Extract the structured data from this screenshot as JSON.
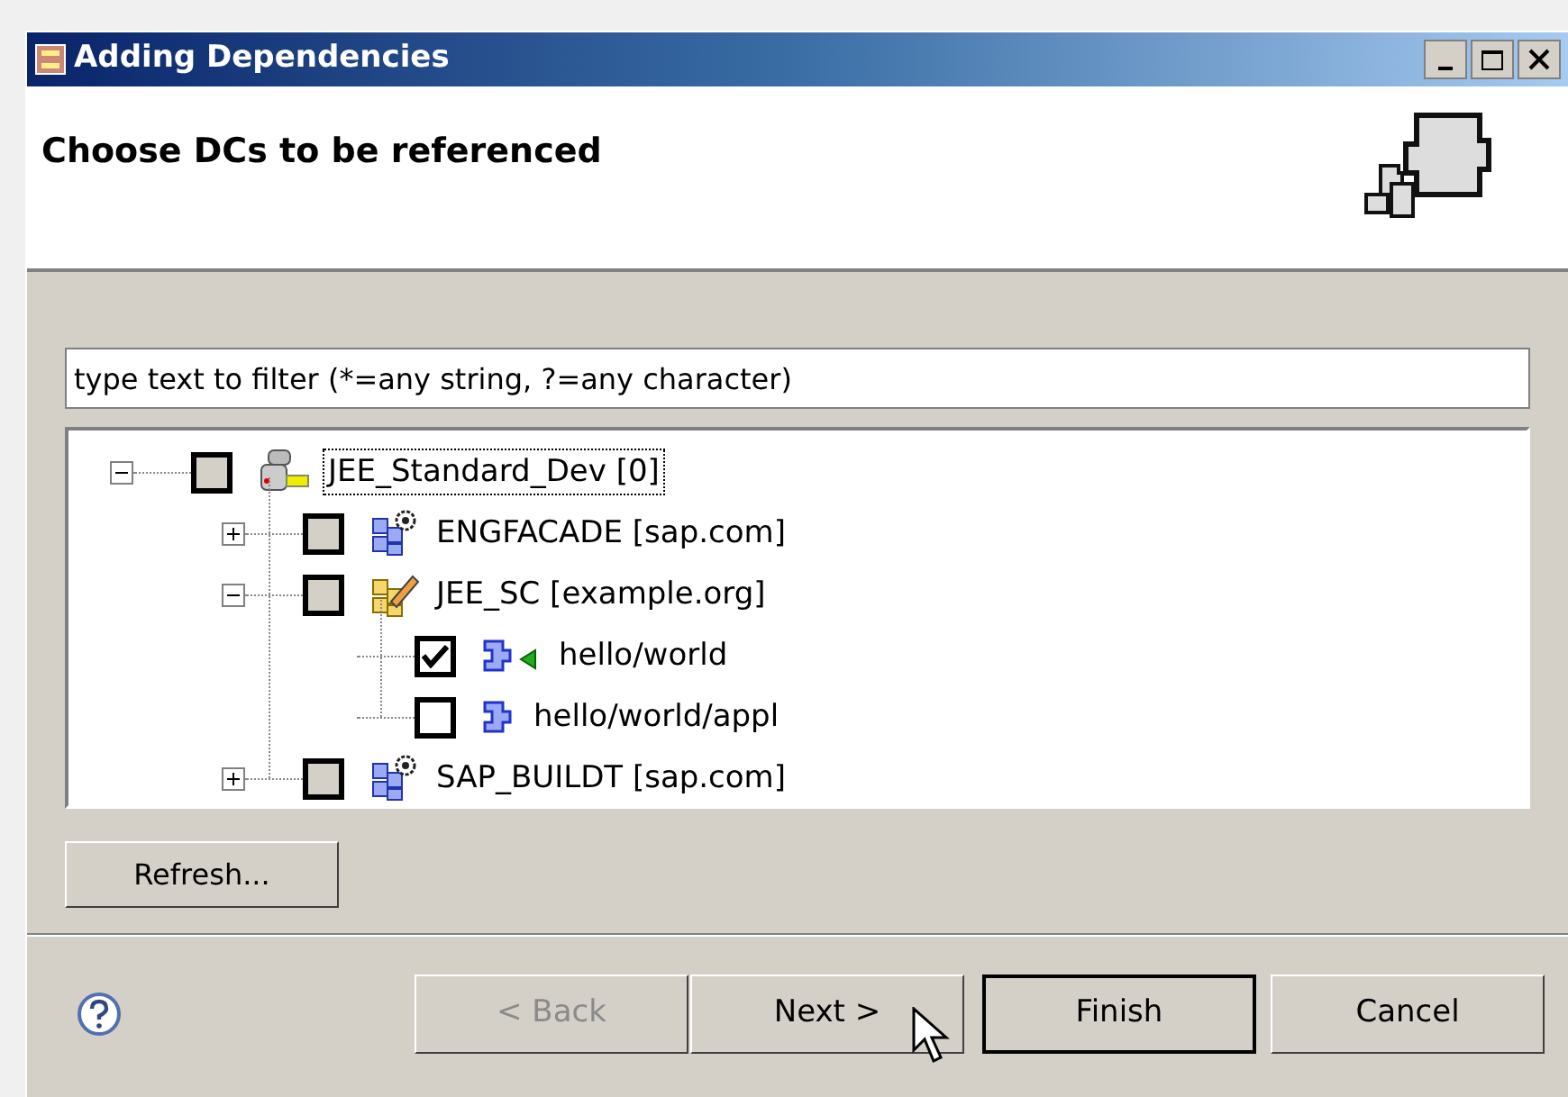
{
  "window": {
    "title": "Adding Dependencies"
  },
  "header": {
    "title": "Choose DCs to be referenced"
  },
  "filter": {
    "placeholder": "type text to filter (*=any string, ?=any character)"
  },
  "tree": [
    {
      "label": "JEE_Standard_Dev [0]",
      "kind": "system",
      "expanded": true,
      "checked": false,
      "selected": true,
      "children": [
        {
          "label": "ENGFACADE [sap.com]",
          "kind": "sc-gear",
          "expanded": false,
          "checked": false,
          "selected": false
        },
        {
          "label": "JEE_SC [example.org]",
          "kind": "sc-edit",
          "expanded": true,
          "checked": false,
          "selected": false,
          "children": [
            {
              "label": "hello/world",
              "kind": "dc-used",
              "checked": true,
              "selected": false
            },
            {
              "label": "hello/world/appl",
              "kind": "dc",
              "checked": false,
              "selected": false
            }
          ]
        },
        {
          "label": "SAP_BUILDT [sap.com]",
          "kind": "sc-gear",
          "expanded": false,
          "checked": false,
          "selected": false
        }
      ]
    }
  ],
  "refresh_button": "Refresh...",
  "buttons": [
    {
      "label": "< Back",
      "disabled": true,
      "default": false
    },
    {
      "label": "Next >",
      "disabled": false,
      "default": false
    },
    {
      "label": "Finish",
      "disabled": false,
      "default": true
    },
    {
      "label": "Cancel",
      "disabled": false,
      "default": false
    }
  ]
}
